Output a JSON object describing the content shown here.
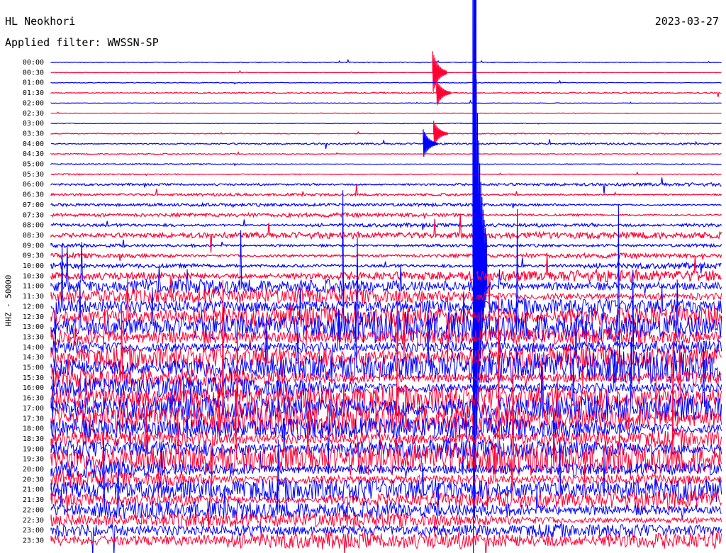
{
  "header": {
    "station": "HL Neokhori",
    "date": "2023-03-27",
    "filter": "Applied filter: WWSSN-SP"
  },
  "chart_data": {
    "type": "line",
    "title": "HL Neokhori",
    "subtitle": "Applied filter: WWSSN-SP",
    "date": "2023-03-27",
    "ylabel": "HHZ - 50000",
    "row_labels": [
      "00:00",
      "00:30",
      "01:00",
      "01:30",
      "02:00",
      "02:30",
      "03:00",
      "03:30",
      "04:00",
      "04:30",
      "05:00",
      "05:30",
      "06:00",
      "06:30",
      "07:00",
      "07:30",
      "08:00",
      "08:30",
      "09:00",
      "09:30",
      "10:00",
      "10:30",
      "11:00",
      "11:30",
      "12:00",
      "12:30",
      "13:00",
      "13:30",
      "14:00",
      "14:30",
      "15:00",
      "15:30",
      "16:00",
      "16:30",
      "17:00",
      "17:30",
      "18:00",
      "18:30",
      "19:00",
      "19:30",
      "20:00",
      "20:30",
      "21:00",
      "21:30",
      "22:00",
      "22:30",
      "23:00",
      "23:30"
    ],
    "trace_colors": [
      "#0000ff",
      "#ff0033"
    ],
    "row_noise_level": [
      0.04,
      0.04,
      0.04,
      0.05,
      0.03,
      0.04,
      0.05,
      0.06,
      0.07,
      0.08,
      0.08,
      0.1,
      0.14,
      0.18,
      0.2,
      0.22,
      0.24,
      0.26,
      0.3,
      0.35,
      0.4,
      0.5,
      0.7,
      0.9,
      1.1,
      1.2,
      1.3,
      1.3,
      1.3,
      1.3,
      1.3,
      1.3,
      1.3,
      1.3,
      1.3,
      1.3,
      1.3,
      1.3,
      1.3,
      1.3,
      1.25,
      1.2,
      1.1,
      1.0,
      0.9,
      0.8,
      0.8,
      0.8
    ],
    "events": [
      {
        "time": "00:30",
        "amplitude": 2.5
      },
      {
        "time": "01:30",
        "amplitude": 1.6
      },
      {
        "time": "03:30",
        "amplitude": 1.5
      },
      {
        "time": "04:00",
        "amplitude": 1.7
      },
      {
        "time": "10:00",
        "amplitude": 40
      }
    ]
  }
}
